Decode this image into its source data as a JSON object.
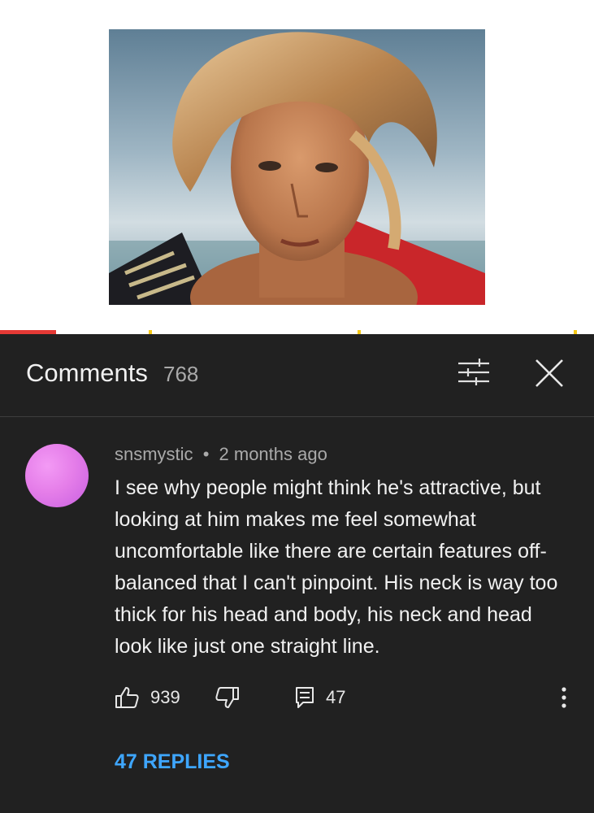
{
  "video": {
    "progress_percent": 9.4,
    "colors": {
      "progress": "#e53935",
      "chapter_marker": "#f6c915"
    }
  },
  "comments_panel": {
    "title": "Comments",
    "count": "768",
    "filter_icon": "sort-filter-icon",
    "close_icon": "close-icon"
  },
  "comment": {
    "author": "snsmystic",
    "separator": "•",
    "time": "2 months ago",
    "text": "I see why people might think he's attractive, but looking at him makes me feel somewhat uncomfortable like there are certain features off-balanced that I can't pinpoint. His neck is way too thick for his head and body, his neck and head look like just one straight line.",
    "likes": "939",
    "reply_count": "47",
    "replies_label": "47 REPLIES",
    "icons": {
      "like": "thumbs-up-icon",
      "dislike": "thumbs-down-icon",
      "reply": "comment-reply-icon",
      "more": "more-vert-icon"
    }
  },
  "colors": {
    "panel_bg": "#212121",
    "link_blue": "#3ea6ff",
    "secondary_text": "#aaaaaa"
  }
}
